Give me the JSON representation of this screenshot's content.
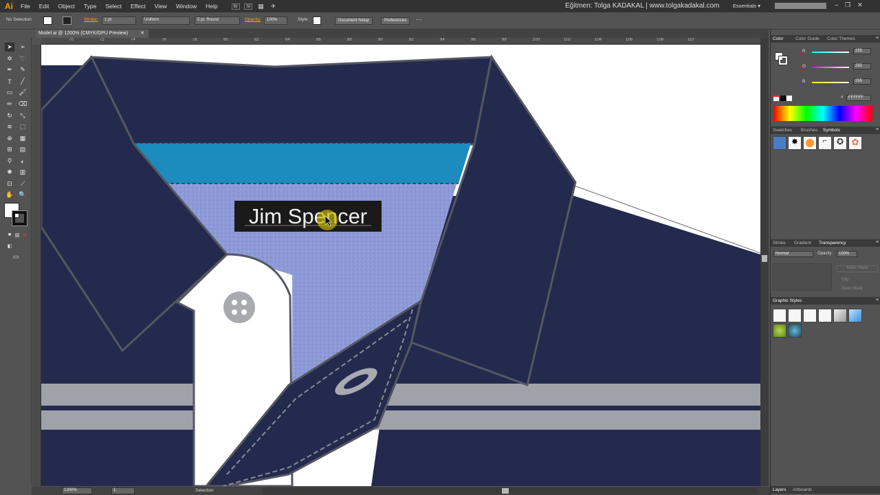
{
  "app": {
    "logo": "Ai",
    "menus": [
      "File",
      "Edit",
      "Object",
      "Type",
      "Select",
      "Effect",
      "View",
      "Window",
      "Help"
    ],
    "bridge": [
      "Br",
      "St"
    ],
    "tutor_text": "Eğitmen: Tolga KADAKAL | www.tolgakadakal.com",
    "workspace": "Essentials",
    "window_buttons": [
      "–",
      "❐",
      "✕"
    ]
  },
  "control": {
    "selection": "No Selection",
    "stroke_label": "Stroke:",
    "stroke_value": "1 pt",
    "stroke_profile": "Uniform",
    "brush": "5 pt. Round",
    "opacity_label": "Opacity:",
    "opacity_value": "100%",
    "style_label": "Style:",
    "doc_setup": "Document Setup",
    "preferences": "Preferences"
  },
  "document": {
    "tab_title": "Model.ai @ 1200% (CMYK/GPU Preview)",
    "close": "✕"
  },
  "ruler": {
    "labels": [
      "70",
      "72",
      "74",
      "76",
      "78",
      "80",
      "82",
      "84",
      "86",
      "88",
      "90",
      "92",
      "94",
      "96",
      "98",
      "100",
      "102",
      "104",
      "106",
      "108",
      "110"
    ]
  },
  "artwork": {
    "name_tag": "Jim Spencer",
    "colors": {
      "navy": "#232a4e",
      "outline": "#555761",
      "stripe_blue": "#1b8cbd",
      "fabric": "#8c98d6",
      "grey_stripe": "#a0a2a9",
      "cursor": "#c4b400"
    }
  },
  "status": {
    "zoom": "1200%",
    "page": "1",
    "tool": "Selection"
  },
  "panels": {
    "color_tabs": [
      "Color",
      "Color Guide",
      "Color Themes"
    ],
    "rgb": [
      {
        "label": "R",
        "value": "255",
        "color": "#e83a3a"
      },
      {
        "label": "G",
        "value": "255",
        "color": "#22c55e"
      },
      {
        "label": "B",
        "value": "255",
        "color": "#3b82f6"
      }
    ],
    "hex": "FFFFFF",
    "hex_label": "#",
    "symbol_tabs": [
      "Swatches",
      "Brushes",
      "Symbols"
    ],
    "transparency_tabs": [
      "Stroke",
      "Gradient",
      "Transparency"
    ],
    "blend_mode": "Normal",
    "opacity_label": "Opacity:",
    "opacity": "100%",
    "make_mask": "Make Mask",
    "clip": "Clip",
    "invert_mask": "Invert Mask",
    "graphic_styles_title": "Graphic Styles",
    "bottom_tabs": [
      "Layers",
      "Artboards"
    ]
  }
}
